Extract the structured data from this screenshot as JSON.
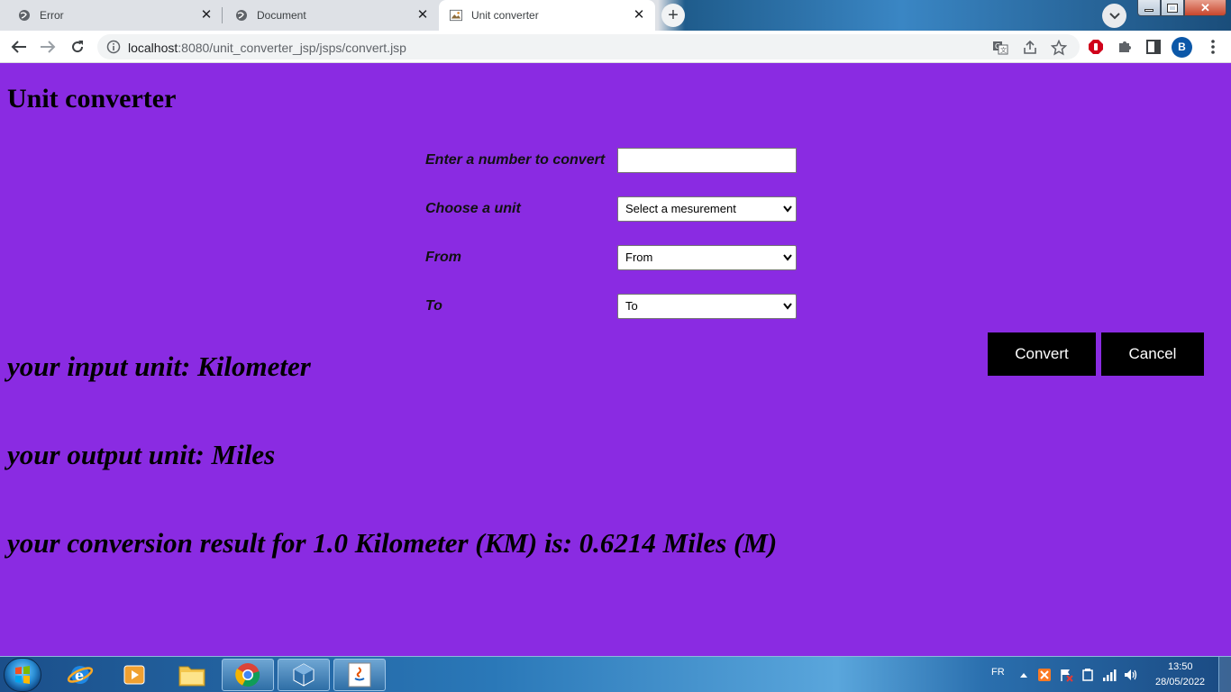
{
  "browser": {
    "tabs": [
      {
        "title": "Error",
        "favicon": "globe-icon"
      },
      {
        "title": "Document",
        "favicon": "globe-icon"
      },
      {
        "title": "Unit converter",
        "favicon": "page-image-icon",
        "active": true
      }
    ],
    "url_host": "localhost",
    "url_rest": ":8080/unit_converter_jsp/jsps/convert.jsp",
    "profile_initial": "B"
  },
  "page": {
    "title": "Unit converter",
    "background_color": "#8a2be2",
    "form": {
      "number_label": "Enter a number to convert",
      "number_value": "",
      "unit_label": "Choose a unit",
      "unit_selected": "Select a mesurement",
      "from_label": "From",
      "from_selected": "From",
      "to_label": "To",
      "to_selected": "To"
    },
    "buttons": {
      "convert": "Convert",
      "cancel": "Cancel"
    },
    "results": {
      "input_unit": "your input unit: Kilometer",
      "output_unit": "your output unit: Miles",
      "conversion": "your conversion result for 1.0 Kilometer (KM) is: 0.6214 Miles (M)"
    }
  },
  "taskbar": {
    "apps": [
      "internet-explorer-icon",
      "media-player-icon",
      "file-explorer-icon",
      "chrome-icon",
      "virtualbox-icon",
      "java-icon"
    ],
    "language": "FR",
    "time": "13:50",
    "date": "28/05/2022"
  }
}
